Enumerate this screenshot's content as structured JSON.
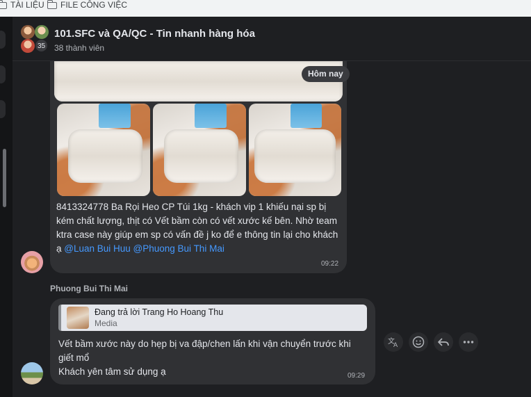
{
  "bookmarks": [
    {
      "label": "TÀI LIỆU"
    },
    {
      "label": "FILE CÔNG VIỆC"
    }
  ],
  "header": {
    "title": "101.SFC và QA/QC - Tin nhanh hàng hóa",
    "members": "38 thành viên",
    "avatar_count": "35"
  },
  "messages": [
    {
      "date_divider": "Hôm nay",
      "text_plain": "8413324778 Ba Rọi Heo CP Túi 1kg - khách vip 1 khiếu nại sp bị kém chất lượng, thịt có Vết bầm còn có vết xước kế bên. Nhờ team ktra case này giúp em sp có vấn đề j ko để e thông tin lại cho khách ạ ",
      "mention_1": "@Luan Bui Huu",
      "mention_2": "@Phuong Bui Thi Mai",
      "time": "09:22"
    },
    {
      "sender": "Phuong Bui Thi Mai",
      "reply_title": "Đang trả lời Trang Ho Hoang Thu",
      "reply_sub": "Media",
      "line_1": "Vết bầm xước này do hẹp bị va đập/chen lấn khi vận chuyển trước khi giết mổ",
      "line_2": "Khách yên tâm sử dụng ạ",
      "time": "09:29"
    }
  ],
  "actions": [
    "translate-icon",
    "emoji-icon",
    "reply-icon",
    "more-icon"
  ]
}
